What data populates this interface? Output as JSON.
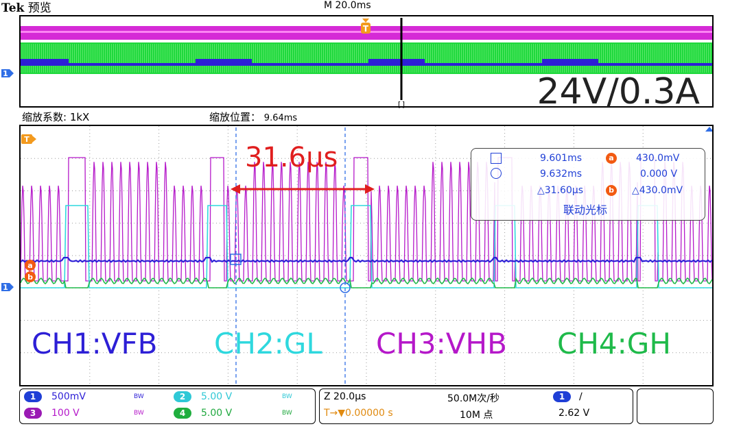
{
  "brand": {
    "tek": "Tek",
    "mode": "预览"
  },
  "overview": {
    "time_label": "M 20.0ms",
    "note": "24V/0.3A"
  },
  "zoom": {
    "factor_label": "缩放系数: 1kX",
    "position_label": "缩放位置：",
    "position_value": "9.64ms"
  },
  "channels": {
    "ch1": {
      "label": "CH1:VFB",
      "color": "#2d1fd6"
    },
    "ch2": {
      "label": "CH2:GL",
      "color": "#2fd8de"
    },
    "ch3": {
      "label": "CH3:VHB",
      "color": "#b518c9"
    },
    "ch4": {
      "label": "CH4:GH",
      "color": "#1fba4a"
    }
  },
  "measurement": {
    "delta": "31.6µs",
    "color": "#e01e1e"
  },
  "cursor_readout": {
    "t1": "9.601ms",
    "t2": "9.632ms",
    "dt": "△31.60µs",
    "va": "430.0mV",
    "vb": "0.000 V",
    "dv": "△430.0mV",
    "a": "a",
    "b": "b",
    "linked": "联动光标"
  },
  "markers": {
    "trigger": "T",
    "ch_ref": "1",
    "a": "a",
    "b": "b",
    "bracket": "[]"
  },
  "bottom": {
    "ch1": {
      "num": "1",
      "scale": "500mV",
      "bw": "BW"
    },
    "ch2": {
      "num": "2",
      "scale": "5.00 V",
      "bw": "BW"
    },
    "ch3": {
      "num": "3",
      "scale": "100 V",
      "bw": "BW"
    },
    "ch4": {
      "num": "4",
      "scale": "5.00 V",
      "bw": "BW"
    },
    "timebase": "Z 20.0µs",
    "trig_delay": "T→▼0.00000 s",
    "sample_rate": "50.0M次/秒",
    "record": "10M 点",
    "trig_ch": "1",
    "trig_slope": "∕",
    "trig_level": "2.62 V"
  },
  "accent": "#f39a1e"
}
